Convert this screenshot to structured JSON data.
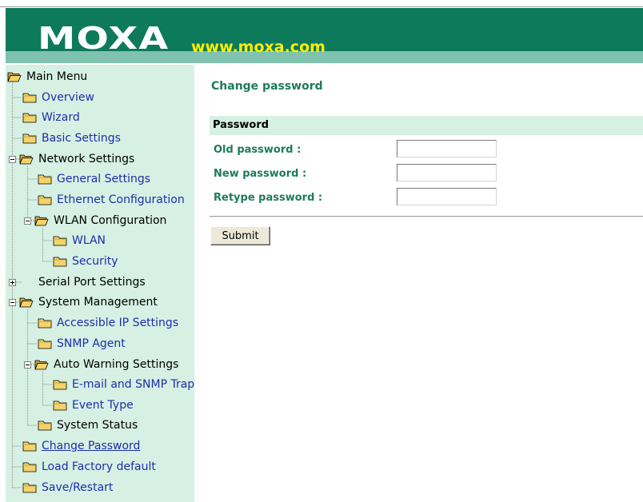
{
  "header": {
    "brand": "MOXA",
    "url": "www.moxa.com"
  },
  "menu": {
    "items": [
      {
        "label": "Main Menu"
      },
      {
        "label": "Overview"
      },
      {
        "label": "Wizard"
      },
      {
        "label": "Basic Settings"
      },
      {
        "label": "Network Settings"
      },
      {
        "label": "General Settings"
      },
      {
        "label": "Ethernet Configuration"
      },
      {
        "label": "WLAN Configuration"
      },
      {
        "label": "WLAN"
      },
      {
        "label": "Security"
      },
      {
        "label": "Serial Port Settings"
      },
      {
        "label": "System Management"
      },
      {
        "label": "Accessible IP Settings"
      },
      {
        "label": "SNMP Agent"
      },
      {
        "label": "Auto Warning Settings"
      },
      {
        "label": "E-mail and SNMP Trap"
      },
      {
        "label": "Event Type"
      },
      {
        "label": "System Status"
      },
      {
        "label": "Change Password"
      },
      {
        "label": "Load Factory default"
      },
      {
        "label": "Save/Restart"
      }
    ]
  },
  "main": {
    "title": "Change password",
    "section": "Password",
    "fields": [
      {
        "label": "Old password :",
        "value": ""
      },
      {
        "label": "New password :",
        "value": ""
      },
      {
        "label": "Retype password :",
        "value": ""
      }
    ],
    "submit_label": "Submit"
  },
  "colors": {
    "header_green": "#0e7a5c",
    "header_band": "#7fc2ae",
    "url_yellow": "#ffee00",
    "sidebar_bg": "#d6f0e4",
    "title_green": "#1e7a5e",
    "link_blue": "#1c2fa8"
  }
}
